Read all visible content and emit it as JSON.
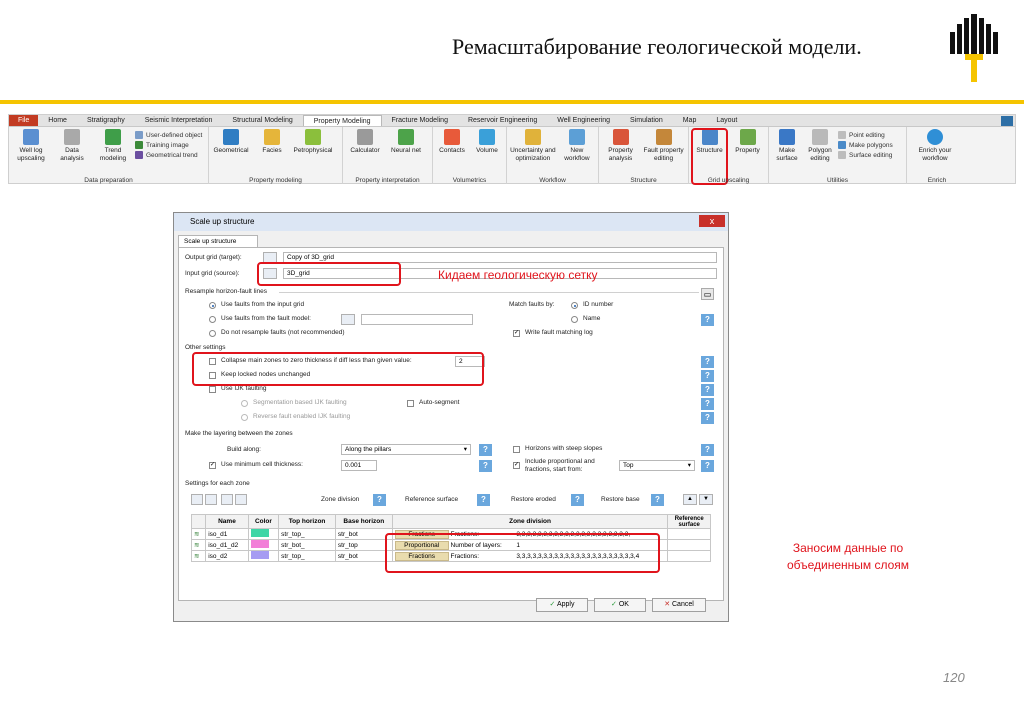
{
  "slide": {
    "title": "Ремасштабирование геологической модели.",
    "page_number": "120",
    "annotation_grid": "Кидаем геологическую сетку",
    "annotation_layers": "Заносим данные по объединенным слоям"
  },
  "ribbon": {
    "tabs": [
      "File",
      "Home",
      "Stratigraphy",
      "Seismic Interpretation",
      "Structural Modeling",
      "Property Modeling",
      "Fracture Modeling",
      "Reservoir Engineering",
      "Well Engineering",
      "Simulation",
      "Map",
      "Layout"
    ],
    "active_tab": "Property Modeling",
    "groups": {
      "data_prep": {
        "label": "Data preparation",
        "btn1": "Well log upscaling",
        "btn2": "Data analysis",
        "btn3": "Trend modeling",
        "small1": "User-defined object",
        "small2": "Training image",
        "small3": "Geometrical trend"
      },
      "prop_model": {
        "label": "Property modeling",
        "btn1": "Geometrical",
        "btn2": "Facies",
        "btn3": "Petrophysical"
      },
      "prop_interp": {
        "label": "Property interpretation",
        "btn1": "Calculator",
        "btn2": "Neural net"
      },
      "volumetrics": {
        "label": "Volumetrics",
        "btn1": "Contacts",
        "btn2": "Volume"
      },
      "workflow": {
        "label": "Workflow",
        "btn1": "Uncertainty and optimization",
        "btn2": "New workflow"
      },
      "structure": {
        "label": "Structure",
        "btn1": "Property analysis",
        "btn2": "Fault property editing"
      },
      "grid_up": {
        "label": "Grid upscaling",
        "btn1": "Structure",
        "btn2": "Property"
      },
      "utilities": {
        "label": "Utilities",
        "btn1": "Make surface",
        "btn2": "Polygon editing",
        "small1": "Point editing",
        "small2": "Make polygons",
        "small3": "Surface editing"
      },
      "enrich": {
        "label": "Enrich",
        "btn1": "Enrich your workflow"
      }
    }
  },
  "dialog": {
    "title": "Scale up structure",
    "tab": "Scale up structure",
    "output_grid_label": "Output grid (target):",
    "output_grid_value": "Copy of 3D_grid",
    "input_grid_label": "Input grid (source):",
    "input_grid_value": "3D_grid",
    "resample_header": "Resample horizon-fault lines",
    "opt_faults_input": "Use faults from the input grid",
    "opt_faults_model": "Use faults from the fault model:",
    "opt_no_resample": "Do not resample faults (not recommended)",
    "match_faults_label": "Match faults by:",
    "match_id": "ID number",
    "match_name": "Name",
    "write_fault": "Write fault matching log",
    "other_header": "Other settings",
    "collapse_label": "Collapse main zones to zero thickness if diff less than given value:",
    "collapse_value": "2",
    "keep_locked": "Keep locked nodes unchanged",
    "use_ijk": "Use IJK faulting",
    "seg_ijk": "Segmentation based IJK faulting",
    "auto_segment": "Auto-segment",
    "rev_ijk": "Reverse fault enabled IJK faulting",
    "layering_header": "Make the layering between the zones",
    "build_along_label": "Build along:",
    "build_along_value": "Along the pillars",
    "horizons_steep": "Horizons with steep slopes",
    "min_cell_label": "Use minimum cell thickness:",
    "min_cell_value": "0.001",
    "include_prop": "Include proportional and fractions, start from:",
    "start_from": "Top",
    "zone_header": "Settings for each zone",
    "zone_division": "Zone division",
    "reference_surface": "Reference surface",
    "restore_eroded": "Restore eroded",
    "restore_base": "Restore base",
    "table_headers": [
      "Name",
      "Color",
      "Top horizon",
      "Base horizon",
      "Zone division",
      "Reference surface"
    ],
    "rows": [
      {
        "name": "iso_d1",
        "color": "#3ed6a6",
        "top": "str_top_",
        "base": "str_bot",
        "type": "Fractions",
        "kind": "Fractions:",
        "value": "3,3,3,3,3,3,3,3,3,3,3,3,3,3,3,3,3,3,3,3,3,"
      },
      {
        "name": "iso_d1_d2",
        "color": "#f27fd8",
        "top": "str_bot_",
        "base": "str_top",
        "type": "Proportional",
        "kind": "Number of layers:",
        "value": "1"
      },
      {
        "name": "iso_d2",
        "color": "#a69cf2",
        "top": "str_top_",
        "base": "str_bot",
        "type": "Fractions",
        "kind": "Fractions:",
        "value": "3,3,3,3,3,3,3,3,3,3,3,3,3,3,3,3,3,3,3,3,3,3,4"
      }
    ],
    "apply": "Apply",
    "ok": "OK",
    "cancel": "Cancel",
    "close": "x"
  }
}
